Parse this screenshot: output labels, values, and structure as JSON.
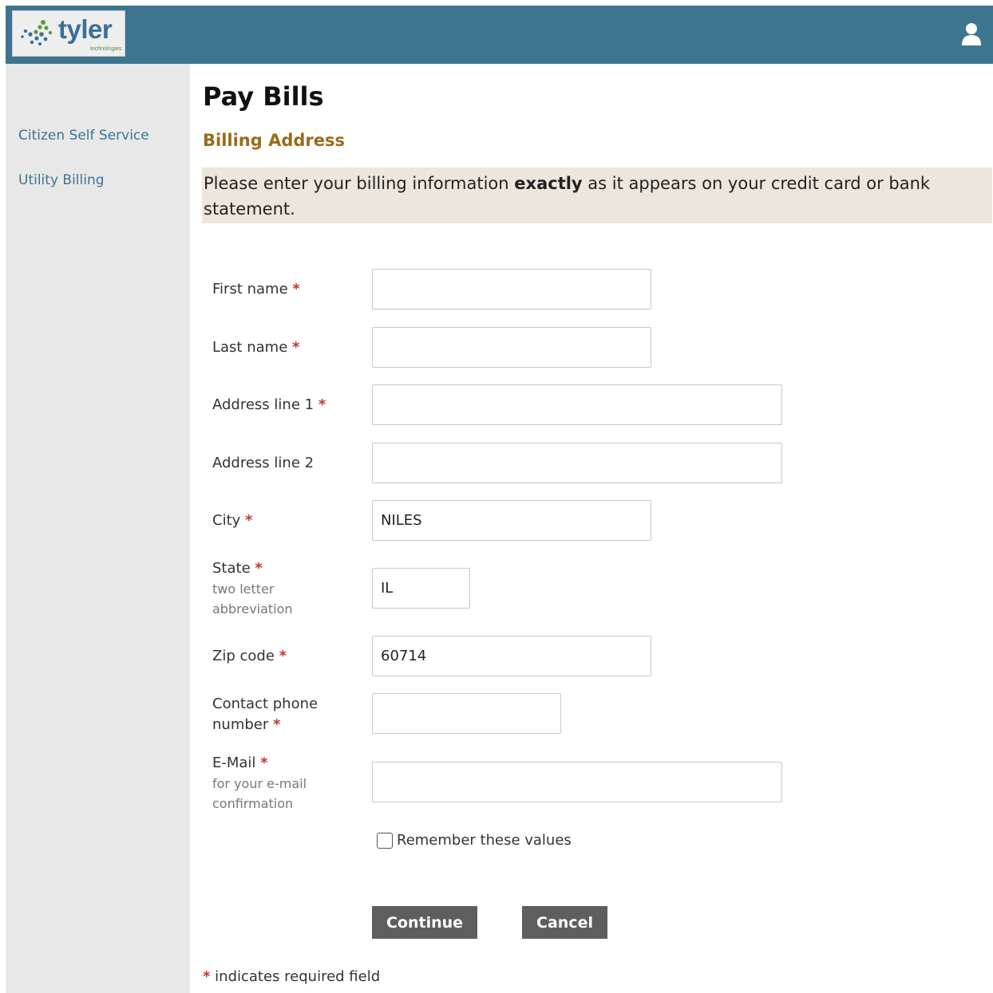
{
  "header": {
    "logo_text": "tyler",
    "logo_subtext": "technologies",
    "user_icon": "user-icon"
  },
  "sidebar": {
    "items": [
      {
        "label": "Citizen Self Service"
      },
      {
        "label": "Utility Billing"
      }
    ]
  },
  "main": {
    "title": "Pay Bills",
    "section_title": "Billing Address",
    "notice_before": "Please enter your billing information ",
    "notice_bold": "exactly",
    "notice_after": " as it appears on your credit card or bank statement."
  },
  "form": {
    "required_marker": "*",
    "fields": {
      "first_name": {
        "label": "First name",
        "value": ""
      },
      "last_name": {
        "label": "Last name",
        "value": ""
      },
      "address1": {
        "label": "Address line 1",
        "value": ""
      },
      "address2": {
        "label": "Address line 2",
        "value": ""
      },
      "city": {
        "label": "City",
        "value": "NILES"
      },
      "state": {
        "label": "State",
        "hint": "two letter abbreviation",
        "value": "IL"
      },
      "zip": {
        "label": "Zip code",
        "value": "60714"
      },
      "phone": {
        "label": "Contact phone number",
        "value": ""
      },
      "email": {
        "label": "E-Mail",
        "hint": "for your e-mail confirmation",
        "value": ""
      }
    },
    "remember_label": "Remember these values",
    "remember_checked": false,
    "continue_label": "Continue",
    "cancel_label": "Cancel",
    "footnote": "indicates required field"
  },
  "colors": {
    "header_bg": "#3d758f",
    "sidebar_bg": "#e8e8e8",
    "link": "#3d758f",
    "section_title": "#9a6b1a",
    "notice_bg": "#ece6dc",
    "required": "#c0392b",
    "button_bg": "#5e5e5e"
  }
}
